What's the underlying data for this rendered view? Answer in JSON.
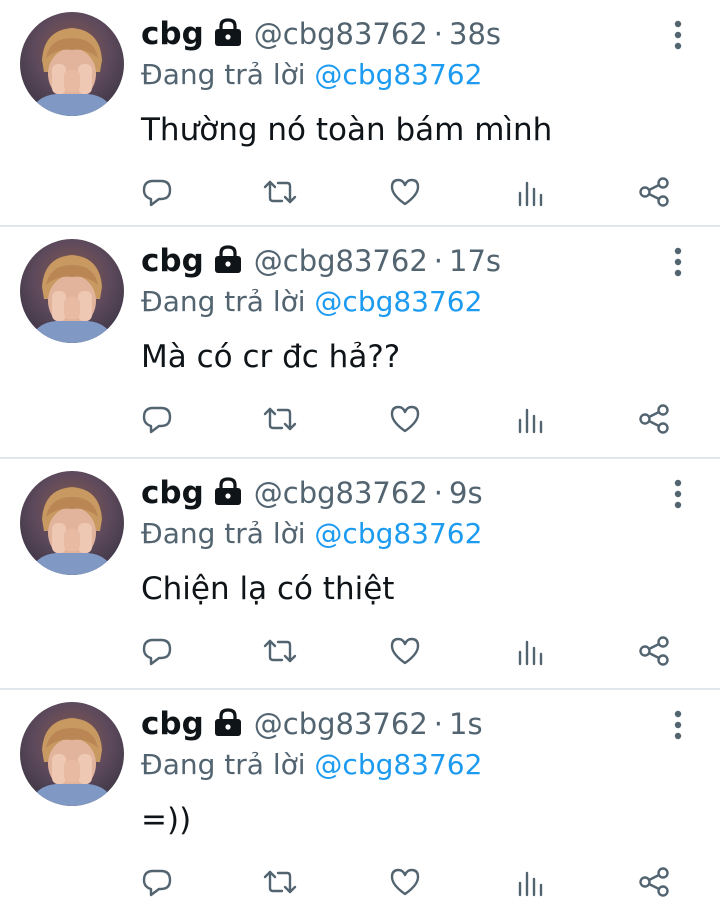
{
  "colors": {
    "text": "#0f1419",
    "secondary": "#536471",
    "mention": "#1d9bf0",
    "divider": "#e1e6ea"
  },
  "tweets": [
    {
      "name": "cbg",
      "handle": "@cbg83762",
      "separator": "·",
      "time": "38s",
      "replying_prefix": "Đang trả lời",
      "replying_to": "@cbg83762",
      "text": "Thường nó toàn bám mình"
    },
    {
      "name": "cbg",
      "handle": "@cbg83762",
      "separator": "·",
      "time": "17s",
      "replying_prefix": "Đang trả lời",
      "replying_to": "@cbg83762",
      "text": "Mà có cr đc hả??"
    },
    {
      "name": "cbg",
      "handle": "@cbg83762",
      "separator": "·",
      "time": "9s",
      "replying_prefix": "Đang trả lời",
      "replying_to": "@cbg83762",
      "text": "Chiện lạ có thiệt"
    },
    {
      "name": "cbg",
      "handle": "@cbg83762",
      "separator": "·",
      "time": "1s",
      "replying_prefix": "Đang trả lời",
      "replying_to": "@cbg83762",
      "text": "=))"
    }
  ],
  "icons": {
    "avatar": "avatar",
    "lock": "lock-icon",
    "more": "more-vertical-icon",
    "reply": "reply-icon",
    "retweet": "retweet-icon",
    "like": "heart-icon",
    "views": "views-bar-chart-icon",
    "share": "share-icon"
  }
}
